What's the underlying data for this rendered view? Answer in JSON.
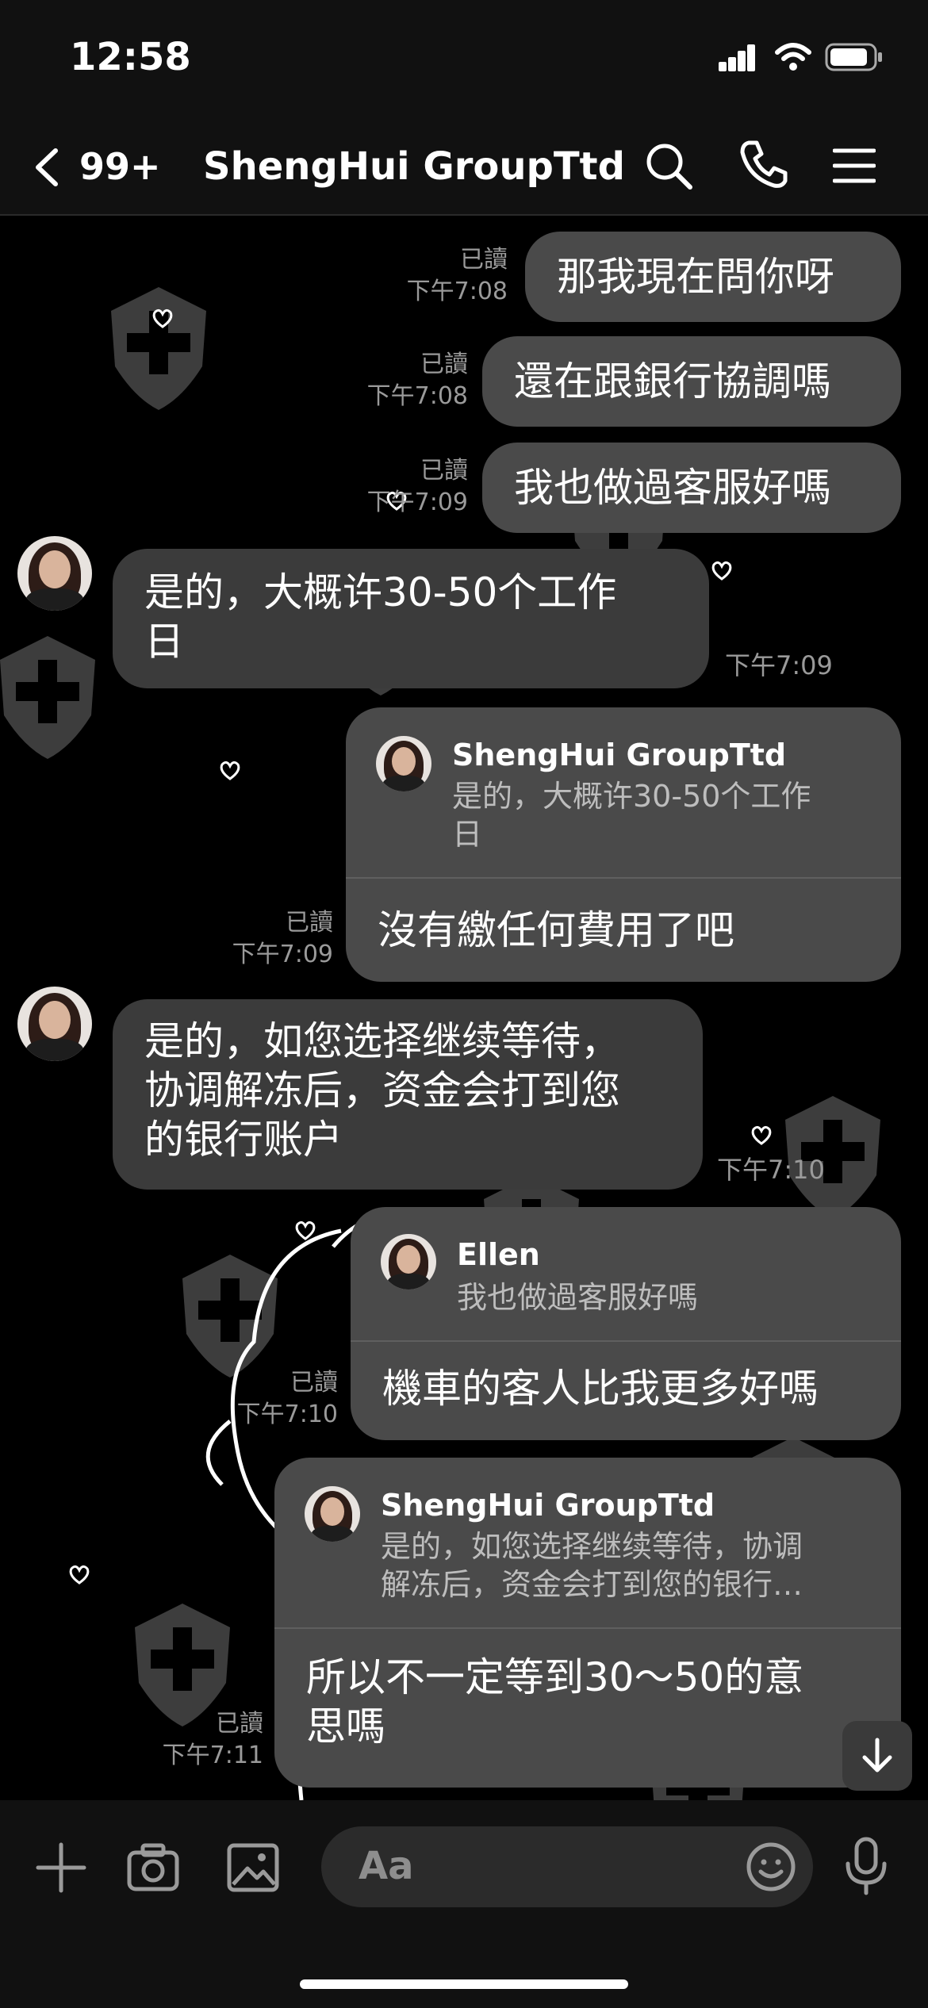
{
  "status_bar": {
    "time": "12:58"
  },
  "header": {
    "unread_count": "99+",
    "title": "ShengHui GroupTtd"
  },
  "messages": [
    {
      "side": "out",
      "text": "那我現在問你呀",
      "read": "已讀",
      "time": "下午7:08"
    },
    {
      "side": "out",
      "text": "還在跟銀行協調嗎",
      "read": "已讀",
      "time": "下午7:08"
    },
    {
      "side": "out",
      "text": "我也做過客服好嗎",
      "read": "已讀",
      "time": "下午7:09"
    },
    {
      "side": "in",
      "text_line1": "是的，大概许30-50个工作",
      "text_line2": "日",
      "time": "下午7:09"
    },
    {
      "side": "out",
      "quote_name": "ShengHui GroupTtd",
      "quote_line1": "是的，大概许30-50个工作",
      "quote_line2": "日",
      "text": "沒有繳任何費用了吧",
      "read": "已讀",
      "time": "下午7:09"
    },
    {
      "side": "in",
      "text_line1": "是的，如您选择继续等待，",
      "text_line2": "协调解冻后，资金会打到您",
      "text_line3": "的银行账户",
      "time": "下午7:10"
    },
    {
      "side": "out",
      "quote_name": "Ellen",
      "quote_line1": "我也做過客服好嗎",
      "text": "機車的客人比我更多好嗎",
      "read": "已讀",
      "time": "下午7:10"
    },
    {
      "side": "out",
      "quote_name": "ShengHui GroupTtd",
      "quote_line1": "是的，如您选择继续等待，协调",
      "quote_line2": "解冻后，资金会打到您的银行…",
      "text_line1": "所以不一定等到30～50的意",
      "text_line2": "思嗎",
      "read": "已讀",
      "time": "下午7:11"
    }
  ],
  "input": {
    "placeholder": "Aa"
  },
  "icons": {
    "back": "chevron-left-icon",
    "search": "search-icon",
    "call": "phone-icon",
    "menu": "hamburger-menu-icon",
    "add": "plus-icon",
    "camera": "camera-icon",
    "gallery": "image-icon",
    "emoji": "emoji-icon",
    "mic": "microphone-icon",
    "scroll_down": "arrow-down-icon"
  },
  "colors": {
    "background": "#000000",
    "bubble_out": "#4a4a4a",
    "bubble_in": "#3b3b3b",
    "meta_text": "#9a9a9a"
  }
}
